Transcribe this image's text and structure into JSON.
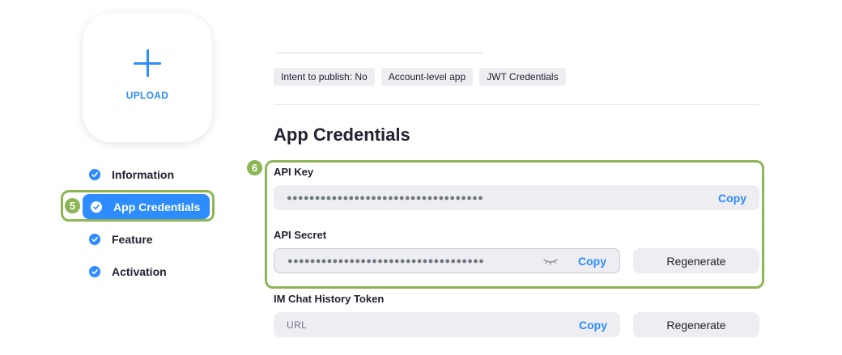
{
  "upload": {
    "label": "UPLOAD",
    "icon": "plus-icon"
  },
  "sidebar": {
    "steps": [
      {
        "label": "Information",
        "icon": "check-circle-icon",
        "active": false
      },
      {
        "label": "App Credentials",
        "icon": "check-circle-icon",
        "active": true
      },
      {
        "label": "Feature",
        "icon": "check-circle-icon",
        "active": false
      },
      {
        "label": "Activation",
        "icon": "check-circle-icon",
        "active": false
      }
    ]
  },
  "callouts": {
    "step_marker": "5",
    "credentials_marker": "6",
    "color": "#8db554"
  },
  "tags": [
    "Intent to publish: No",
    "Account-level app",
    "JWT Credentials"
  ],
  "section_title": "App Credentials",
  "api_key": {
    "label": "API Key",
    "value": "●●●●●●●●●●●●●●●●●●●●●●●●●●●●●●●●●●●",
    "copy_label": "Copy"
  },
  "api_secret": {
    "label": "API Secret",
    "value": "●●●●●●●●●●●●●●●●●●●●●●●●●●●●●●●●●●●",
    "copy_label": "Copy",
    "regenerate_label": "Regenerate",
    "icon": "eye-closed-icon"
  },
  "im_token": {
    "label": "IM Chat History Token",
    "placeholder": "URL",
    "copy_label": "Copy",
    "regenerate_label": "Regenerate"
  },
  "colors": {
    "accent": "#2d8cff",
    "text": "#222230",
    "field_bg": "#ededf2"
  }
}
